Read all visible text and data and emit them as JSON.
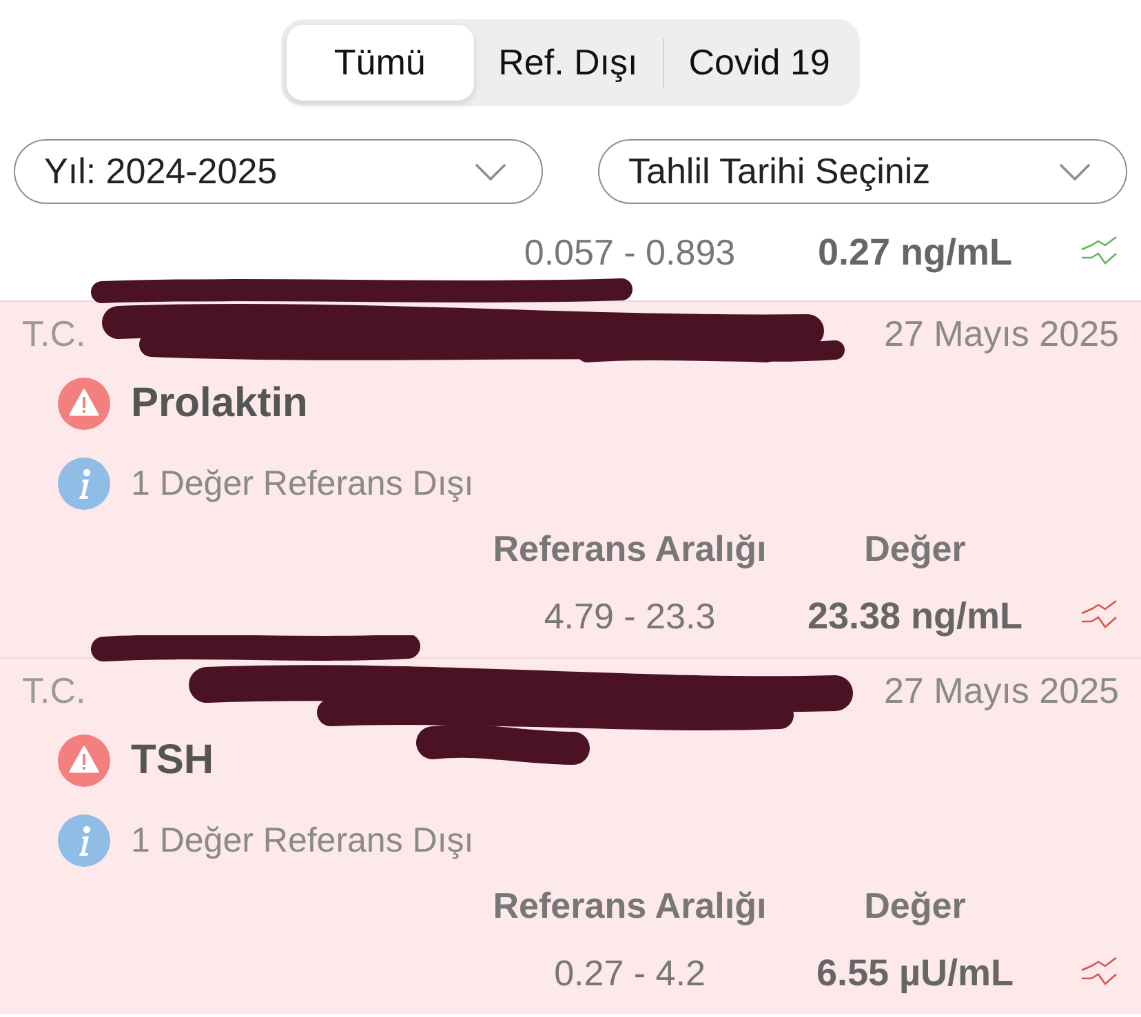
{
  "segments": [
    {
      "label": "Tümü",
      "selected": true
    },
    {
      "label": "Ref. Dışı",
      "selected": false
    },
    {
      "label": "Covid 19",
      "selected": false
    }
  ],
  "filters": [
    {
      "label": "Yıl: 2024-2025"
    },
    {
      "label": "Tahlil Tarihi Seçiniz"
    }
  ],
  "results": [
    {
      "kind": "row",
      "reference_range": "0.057 - 0.893",
      "value": "0.27 ng/mL",
      "out_of_range": false
    },
    {
      "kind": "card",
      "hospital": "T.C.",
      "date": "27 Mayıs 2025",
      "redacted": true,
      "test": "Prolaktin",
      "note": "1 Değer Referans Dışı",
      "range_header": "Referans Aralığı",
      "value_header": "Değer",
      "reference_range": "4.79 - 23.3",
      "value": "23.38 ng/mL",
      "out_of_range": true
    },
    {
      "kind": "card",
      "hospital": "T.C.",
      "date": "27 Mayıs 2025",
      "redacted": true,
      "test": "TSH",
      "note": "1 Değer Referans Dışı",
      "range_header": "Referans Aralığı",
      "value_header": "Değer",
      "reference_range": "0.27 - 4.2",
      "value": "6.55 µU/mL",
      "out_of_range": true
    }
  ]
}
